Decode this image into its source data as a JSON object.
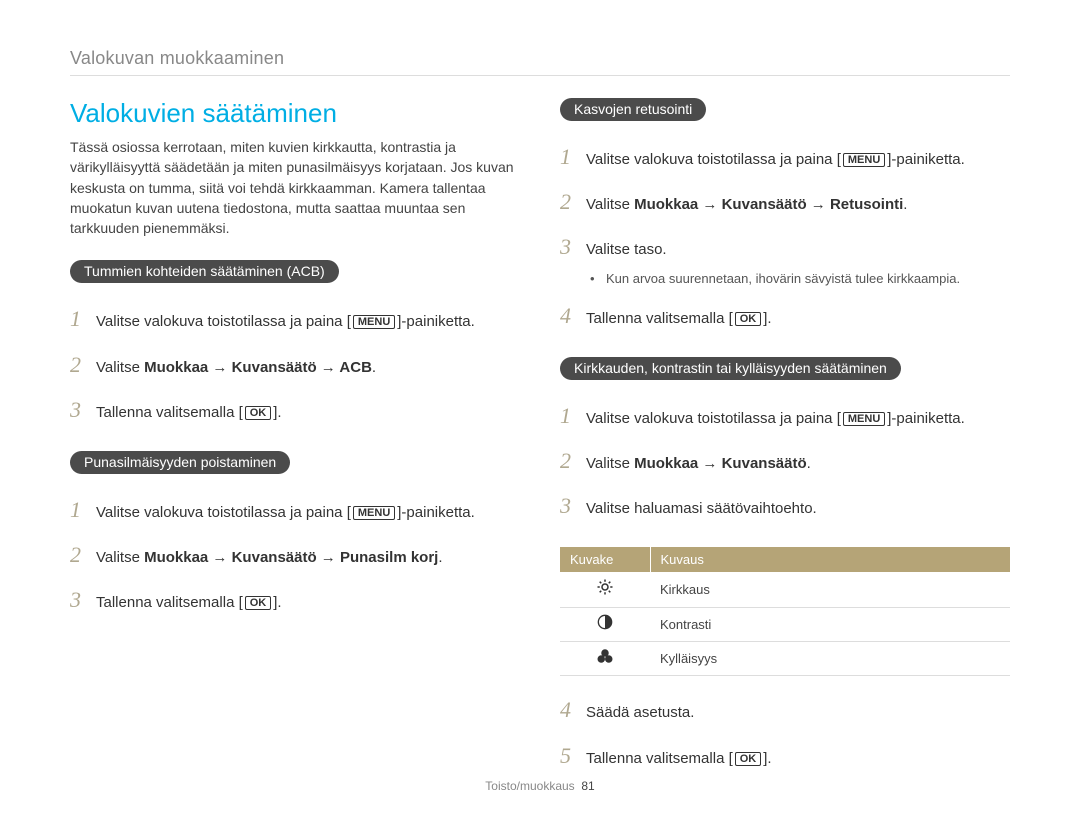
{
  "breadcrumb": "Valokuvan muokkaaminen",
  "left": {
    "heading": "Valokuvien säätäminen",
    "intro": "Tässä osiossa kerrotaan, miten kuvien kirkkautta, kontrastia ja värikylläisyyttä säädetään ja miten punasilmäisyys korjataan. Jos kuvan keskusta on tumma, siitä voi tehdä kirkkaamman. Kamera tallentaa muokatun kuvan uutena tiedostona, mutta saattaa muuntaa sen tarkkuuden pienemmäksi.",
    "section1": {
      "pill": "Tummien kohteiden säätäminen (ACB)",
      "step1a": "Valitse valokuva toistotilassa ja paina [",
      "step1_menu": "MENU",
      "step1b": "]-painiketta.",
      "step2a": "Valitse ",
      "step2b": "Muokkaa → Kuvansäätö → ACB",
      "step2c": ".",
      "step3a": "Tallenna valitsemalla [",
      "step3_ok": "OK",
      "step3b": "]."
    },
    "section2": {
      "pill": "Punasilmäisyyden poistaminen",
      "step1a": "Valitse valokuva toistotilassa ja paina [",
      "step1_menu": "MENU",
      "step1b": "]-painiketta.",
      "step2a": "Valitse ",
      "step2b": "Muokkaa → Kuvansäätö → Punasilm korj",
      "step2c": ".",
      "step3a": "Tallenna valitsemalla [",
      "step3_ok": "OK",
      "step3b": "]."
    }
  },
  "right": {
    "section1": {
      "pill": "Kasvojen retusointi",
      "step1a": "Valitse valokuva toistotilassa ja paina [",
      "step1_menu": "MENU",
      "step1b": "]-painiketta.",
      "step2a": "Valitse ",
      "step2b": "Muokkaa → Kuvansäätö → Retusointi",
      "step2c": ".",
      "step3": "Valitse taso.",
      "note": "Kun arvoa suurennetaan, ihovärin sävyistä tulee kirkkaampia.",
      "step4a": "Tallenna valitsemalla [",
      "step4_ok": "OK",
      "step4b": "]."
    },
    "section2": {
      "pill": "Kirkkauden, kontrastin tai kylläisyyden säätäminen",
      "step1a": "Valitse valokuva toistotilassa ja paina [",
      "step1_menu": "MENU",
      "step1b": "]-painiketta.",
      "step2a": "Valitse ",
      "step2b": "Muokkaa → Kuvansäätö",
      "step2c": ".",
      "step3": "Valitse haluamasi säätövaihtoehto.",
      "table": {
        "h1": "Kuvake",
        "h2": "Kuvaus",
        "rows": [
          {
            "icon": "☀",
            "label": "Kirkkaus"
          },
          {
            "icon": "◐",
            "label": "Kontrasti"
          },
          {
            "icon": "⚫⚫⚫",
            "label": "Kylläisyys"
          }
        ]
      },
      "step4": "Säädä asetusta.",
      "step5a": "Tallenna valitsemalla [",
      "step5_ok": "OK",
      "step5b": "]."
    }
  },
  "footer": {
    "label": "Toisto/muokkaus",
    "page": "81"
  }
}
